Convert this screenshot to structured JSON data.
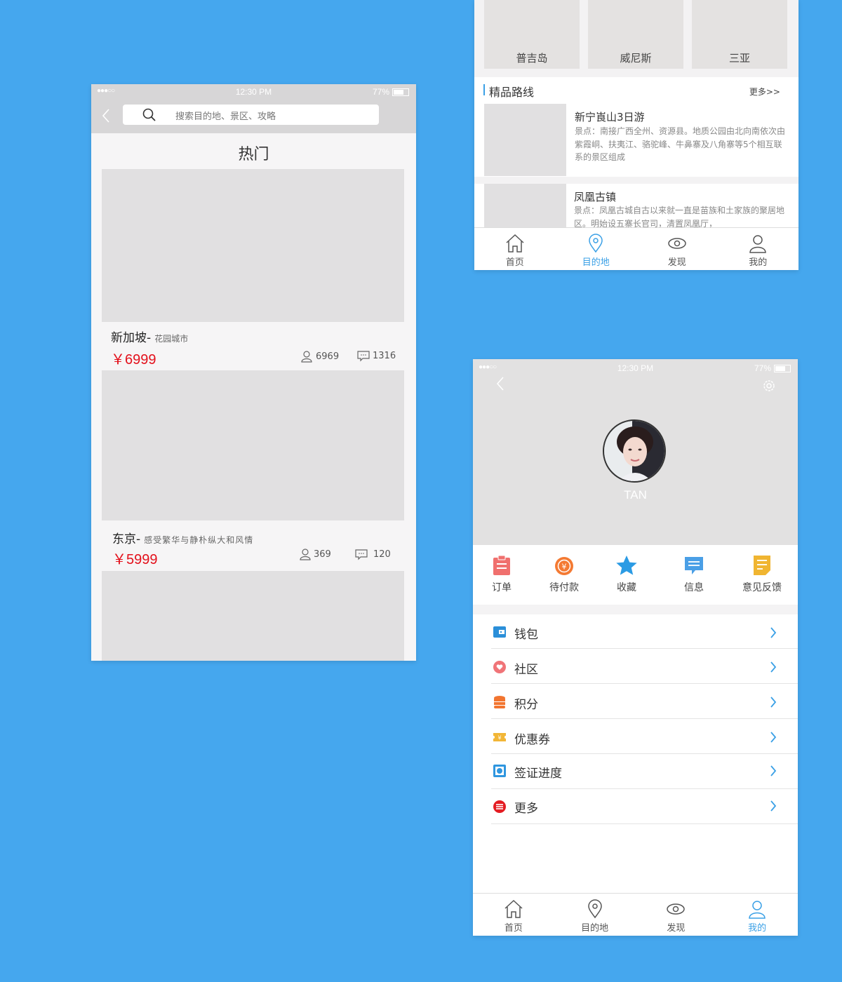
{
  "colors": {
    "background": "#45a7ee",
    "accent": "#3aa0e6",
    "price": "#e3101b"
  },
  "status": {
    "time": "12:30 PM",
    "battery": "77%"
  },
  "hot_screen": {
    "search_placeholder": "搜索目的地、景区、攻略",
    "title": "热门",
    "items": [
      {
        "name": "新加坡-",
        "subtitle": "花园城市",
        "price": "￥6999",
        "views": "6969",
        "comments": "1316"
      },
      {
        "name": "东京-",
        "subtitle": "感受繁华与静朴纵大和风情",
        "price": "￥5999",
        "views": "369",
        "comments": "120"
      }
    ]
  },
  "destination_screen": {
    "top_places": [
      "普吉岛",
      "威尼斯",
      "三亚"
    ],
    "section_title": "精品路线",
    "more_label": "更多>>",
    "routes": [
      {
        "title": "新宁崀山3日游",
        "desc": "景点：南接广西全州、资源县。地质公园由北向南依次由紫霞峒、扶夷江、骆驼峰、牛鼻寨及八角寨等5个相互联系的景区组成"
      },
      {
        "title": "凤凰古镇",
        "desc": "景点：凤凰古城自古以来就一直是苗族和土家族的聚居地区。明始设五寨长官司，清置凤凰厅，"
      }
    ],
    "tabs": [
      {
        "label": "首页",
        "icon": "home-icon"
      },
      {
        "label": "目的地",
        "icon": "location-pin-icon"
      },
      {
        "label": "发现",
        "icon": "eye-icon"
      },
      {
        "label": "我的",
        "icon": "user-icon"
      }
    ],
    "active_tab": "目的地"
  },
  "profile_screen": {
    "username": "TAN",
    "quick_actions": [
      {
        "label": "订单",
        "icon": "clipboard-icon",
        "color": "#f0706e"
      },
      {
        "label": "待付款",
        "icon": "yuan-circle-icon",
        "color": "#f47a33"
      },
      {
        "label": "收藏",
        "icon": "star-icon",
        "color": "#2b9be4"
      },
      {
        "label": "信息",
        "icon": "message-icon",
        "color": "#4a9fe6"
      },
      {
        "label": "意见反馈",
        "icon": "feedback-icon",
        "color": "#f0b531"
      }
    ],
    "menu": [
      {
        "label": "钱包",
        "icon": "wallet-icon",
        "color": "#2b8fd9"
      },
      {
        "label": "社区",
        "icon": "community-icon",
        "color": "#f07478"
      },
      {
        "label": "积分",
        "icon": "coins-icon",
        "color": "#f27530"
      },
      {
        "label": "优惠券",
        "icon": "coupon-icon",
        "color": "#f2b637"
      },
      {
        "label": "签证进度",
        "icon": "visa-icon",
        "color": "#2f96df"
      },
      {
        "label": "更多",
        "icon": "more-icon",
        "color": "#e41d23"
      }
    ],
    "tabs": [
      {
        "label": "首页",
        "icon": "home-icon"
      },
      {
        "label": "目的地",
        "icon": "location-pin-icon"
      },
      {
        "label": "发现",
        "icon": "eye-icon"
      },
      {
        "label": "我的",
        "icon": "user-icon"
      }
    ],
    "active_tab": "我的"
  }
}
